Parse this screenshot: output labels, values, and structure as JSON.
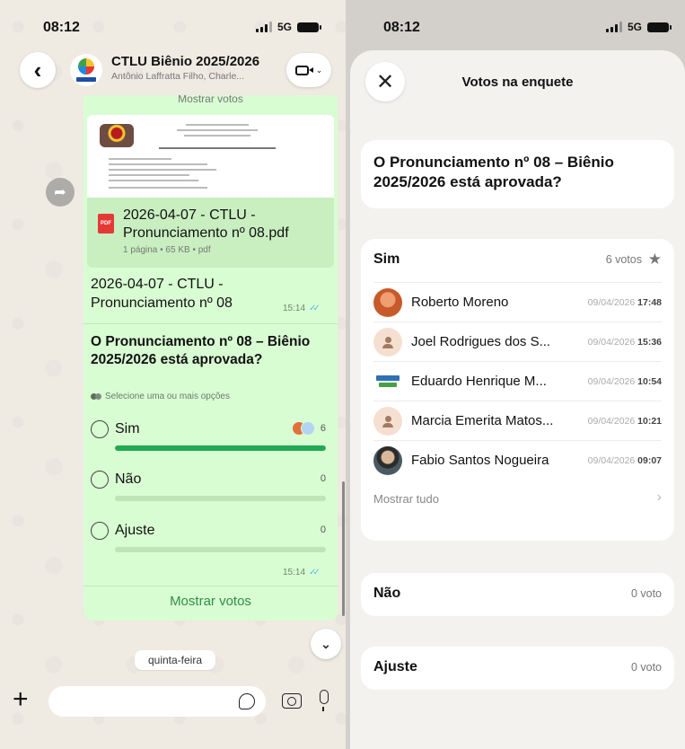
{
  "left": {
    "status": {
      "time": "08:12",
      "network": "5G"
    },
    "header": {
      "title": "CTLU Biênio 2025/2026",
      "subtitle": "Antônio Laffratta Filho, Charle..."
    },
    "previous_caption": "Mostrar votos",
    "document": {
      "name": "2026-04-07 - CTLU - Pronunciamento nº 08.pdf",
      "meta": "1 página • 65 KB • pdf",
      "icon_label": "PDF",
      "caption": "2026-04-07 - CTLU - Pronunciamento nº 08",
      "time": "15:14"
    },
    "poll": {
      "question": "O Pronunciamento nº 08 – Biênio 2025/2026 está aprovada?",
      "hint": "Selecione uma ou mais opções",
      "options": [
        {
          "label": "Sim",
          "count": "6",
          "share": 1.0
        },
        {
          "label": "Não",
          "count": "0",
          "share": 0.0
        },
        {
          "label": "Ajuste",
          "count": "0",
          "share": 0.0
        }
      ],
      "time": "15:14",
      "show_votes": "Mostrar votos"
    },
    "day_label": "quinta-feira",
    "input": {
      "placeholder": ""
    }
  },
  "right": {
    "status": {
      "time": "08:12",
      "network": "5G"
    },
    "sheet_title": "Votos na enquete",
    "question": "O Pronunciamento nº 08 – Biênio 2025/2026 está aprovada?",
    "groups": [
      {
        "name": "Sim",
        "count": "6 votos",
        "voters": [
          {
            "name": "Roberto Moreno",
            "date": "09/04/2026",
            "time": "17:48"
          },
          {
            "name": "Joel Rodrigues dos S...",
            "date": "09/04/2026",
            "time": "15:36"
          },
          {
            "name": "Eduardo Henrique M...",
            "date": "09/04/2026",
            "time": "10:54"
          },
          {
            "name": "Marcia Emerita Matos...",
            "date": "09/04/2026",
            "time": "10:21"
          },
          {
            "name": "Fabio Santos Nogueira",
            "date": "09/04/2026",
            "time": "09:07"
          }
        ],
        "show_all": "Mostrar tudo"
      },
      {
        "name": "Não",
        "count": "0 voto"
      },
      {
        "name": "Ajuste",
        "count": "0 voto"
      }
    ]
  }
}
